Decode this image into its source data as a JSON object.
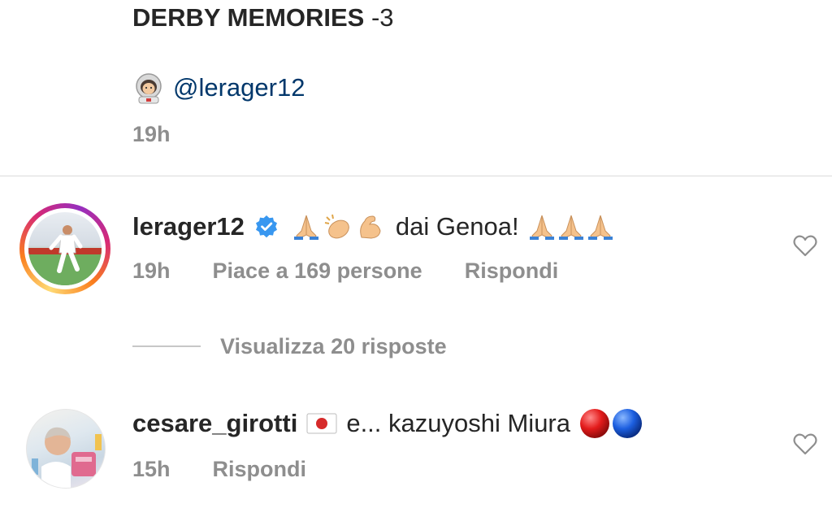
{
  "caption": {
    "title": "DERBY MEMORIES",
    "title_suffix": "-3",
    "mention": "@lerager12",
    "time": "19h"
  },
  "comments": [
    {
      "username": "lerager12",
      "verified": true,
      "text": "dai Genoa!",
      "time": "19h",
      "likes_text": "Piace a 169 persone",
      "reply_label": "Rispondi",
      "avatar_ring": true
    },
    {
      "username": "cesare_girotti",
      "verified": false,
      "text": "e... kazuyoshi Miura",
      "time": "15h",
      "reply_label": "Rispondi",
      "avatar_ring": false
    }
  ],
  "view_replies": {
    "label": "Visualizza 20 risposte"
  },
  "icons": {
    "caption_emoji": "astronaut-emoji",
    "verified": "verified-badge-icon",
    "like": "heart-outline-icon",
    "praying_hands": "folded-hands-emoji",
    "clapping": "clapping-hands-emoji",
    "flexed_arm": "flexed-biceps-emoji",
    "japan_flag": "japan-flag-emoji",
    "red_ball": "red-circle-emoji",
    "blue_ball": "blue-circle-emoji"
  },
  "colors": {
    "text": "#262626",
    "secondary": "#8e8e8e",
    "link": "#00376b",
    "verified": "#3897f0",
    "divider": "#dbdbdb"
  }
}
